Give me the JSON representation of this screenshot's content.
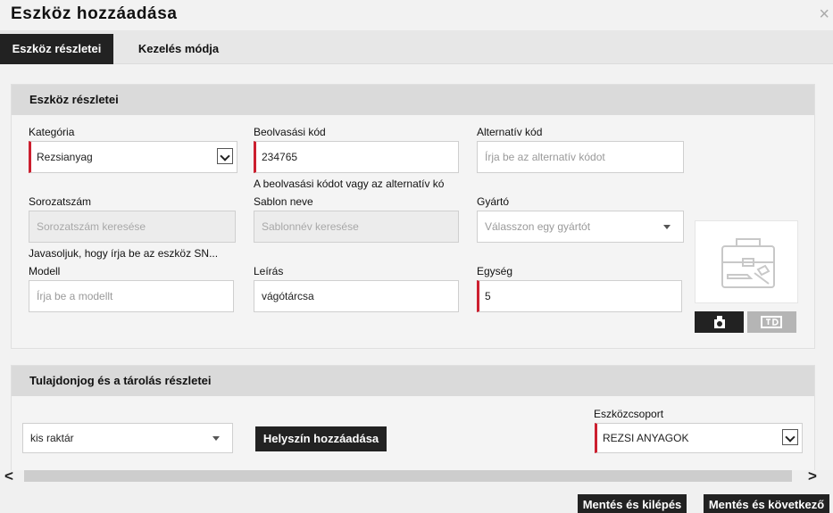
{
  "dialog": {
    "title": "Eszköz hozzáadása",
    "close_glyph": "×"
  },
  "tabs": [
    {
      "label": "Eszköz részletei",
      "active": true
    },
    {
      "label": "Kezelés módja",
      "active": false
    }
  ],
  "details_section": {
    "header": "Eszköz részletei",
    "category": {
      "label": "Kategória",
      "value": "Rezsianyag"
    },
    "scan_code": {
      "label": "Beolvasási kód",
      "value": "234765",
      "hint": "A beolvasási kódot vagy az alternatív kó"
    },
    "alt_code": {
      "label": "Alternatív kód",
      "placeholder": "Írja be az alternatív kódot"
    },
    "serial": {
      "label": "Sorozatszám",
      "placeholder": "Sorozatszám keresése",
      "hint": "Javasoljuk, hogy írja be az eszköz SN..."
    },
    "template": {
      "label": "Sablon neve",
      "placeholder": "Sablonnév keresése"
    },
    "manufacturer": {
      "label": "Gyártó",
      "placeholder": "Válasszon egy gyártót"
    },
    "model": {
      "label": "Modell",
      "placeholder": "Írja be a modellt"
    },
    "description": {
      "label": "Leírás",
      "value": "vágótárcsa"
    },
    "unit": {
      "label": "Egység",
      "value": "5"
    }
  },
  "ownership_section": {
    "header": "Tulajdonjog és a tárolás részletei",
    "location": {
      "value": "kis raktár"
    },
    "add_location_label": "Helyszín hozzáadása",
    "asset_group": {
      "label": "Eszközcsoport",
      "value": "REZSI ANYAGOK"
    }
  },
  "scrollbar": {
    "left_arrow": "<",
    "right_arrow": ">"
  },
  "footer": {
    "save_exit_label": "Mentés és kilépés",
    "save_next_label": "Mentés és következő"
  },
  "colors": {
    "required_marker": "#cc1f2f",
    "dark_button": "#222222",
    "panel_header": "#dadada"
  },
  "icons": [
    "close-icon",
    "toolbox-icon",
    "camera-upload-icon",
    "image-toggle-icon",
    "chevron-down-icon",
    "dropdown-caret-icon"
  ]
}
